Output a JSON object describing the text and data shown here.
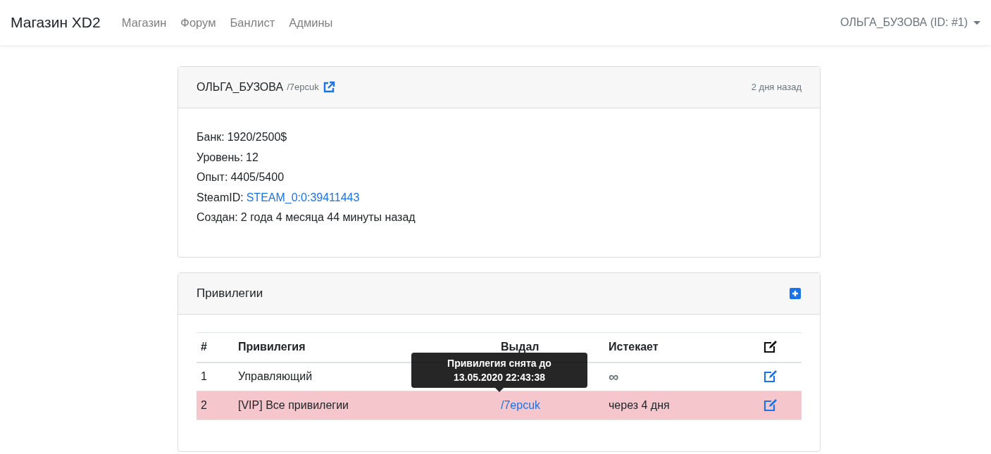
{
  "navbar": {
    "brand": "Магазин XD2",
    "links": [
      {
        "label": "Магазин"
      },
      {
        "label": "Форум"
      },
      {
        "label": "Банлист"
      },
      {
        "label": "Админы"
      }
    ],
    "user_menu": "ОЛЬГА_БУЗОВА (ID: #1)"
  },
  "profile": {
    "name": "ОЛЬГА_БУЗОВА",
    "handle": "/7epcuk",
    "time": "2 дня назад",
    "lines": [
      {
        "label": "Банк:",
        "value": "1920/2500$",
        "kind": "text"
      },
      {
        "label": "Уровень:",
        "value": "12",
        "kind": "text"
      },
      {
        "label": "Опыт:",
        "value": "4405/5400",
        "kind": "text"
      },
      {
        "label": "SteamID:",
        "value": "STEAM_0:0:39411443",
        "kind": "link"
      },
      {
        "label": "Создан:",
        "value": "2 года 4 месяца 44 минуты назад",
        "kind": "text"
      }
    ]
  },
  "privileges": {
    "title": "Привилегии",
    "columns": [
      "#",
      "Привилегия",
      "Выдал",
      "Истекает"
    ],
    "rows": [
      {
        "number": "1",
        "privilege": "Управляющий",
        "expires": {
          "text": "∞",
          "kind": "symbol"
        },
        "revoked": false
      },
      {
        "number": "2",
        "privilege": "[VIP] Все привилегии",
        "issued_by": "/7epcuk",
        "expires": {
          "text": "через 4 дня",
          "kind": "text"
        },
        "revoked": true
      }
    ],
    "tooltip": [
      "Привилегия снята до",
      "13.05.2020 22:43:38"
    ]
  }
}
